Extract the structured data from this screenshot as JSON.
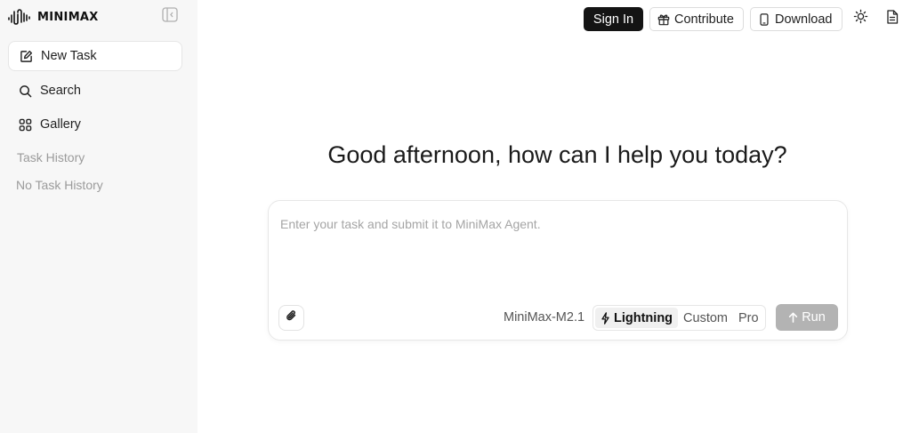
{
  "brand": {
    "name": "MINIMAX",
    "logo_icon": "waveform-logo-icon"
  },
  "sidebar": {
    "collapse_icon": "sidebar-collapse-icon",
    "items": [
      {
        "label": "New Task",
        "icon": "edit-icon",
        "active": true
      },
      {
        "label": "Search",
        "icon": "search-icon",
        "active": false
      },
      {
        "label": "Gallery",
        "icon": "grid-icon",
        "active": false
      }
    ],
    "history_title": "Task History",
    "history_empty": "No Task History"
  },
  "topbar": {
    "signin_label": "Sign In",
    "contribute_label": "Contribute",
    "download_label": "Download",
    "theme_icon": "sun-icon",
    "docs_icon": "document-icon"
  },
  "main": {
    "greeting": "Good afternoon, how can I help you today?",
    "composer": {
      "placeholder": "Enter your task and submit it to MiniMax Agent.",
      "value": "",
      "model": "MiniMax-M2.1",
      "modes": [
        "Lightning",
        "Custom",
        "Pro"
      ],
      "active_mode": "Lightning",
      "run_label": "Run"
    }
  },
  "colors": {
    "primary_button": "#141414",
    "run_disabled": "#b3b3b3",
    "sidebar_bg": "#f7f7f7"
  }
}
